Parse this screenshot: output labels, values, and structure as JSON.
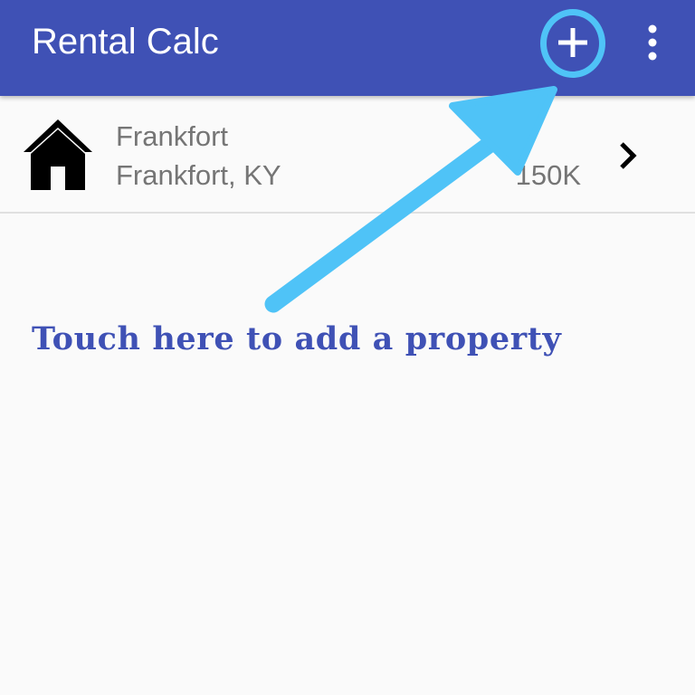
{
  "app_bar": {
    "title": "Rental Calc",
    "background_color": "#3f51b5",
    "add_icon": "plus-icon",
    "menu_icon": "more-vert-icon"
  },
  "properties": [
    {
      "name": "Frankfort",
      "location": "Frankfort, KY",
      "price": "150K",
      "icon": "house-icon",
      "trailing_icon": "chevron-right-icon"
    }
  ],
  "overlay": {
    "hint": "Touch here to add a property",
    "highlight_color": "#4fc3f7",
    "hint_color": "#3f51b5"
  }
}
